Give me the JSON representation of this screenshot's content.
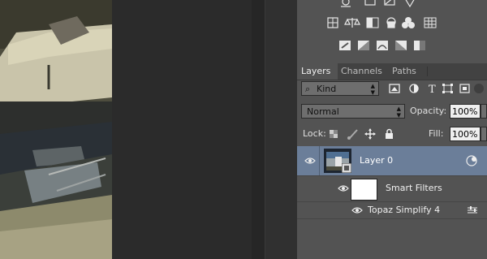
{
  "colors": {
    "panel_bg": "#535353",
    "selected_layer_bg": "#6b7e99",
    "tab_bar_bg": "#424242",
    "pasteboard": "#2b2b2b"
  },
  "adjustments": {
    "icons": [
      "brightness-contrast-icon",
      "levels-icon",
      "curves-icon",
      "exposure-icon",
      "vibrance-icon",
      "hue-saturation-icon",
      "color-balance-icon",
      "black-white-icon",
      "photo-filter-icon",
      "channel-mixer-icon",
      "color-lookup-icon",
      "invert-icon",
      "posterize-icon",
      "threshold-icon",
      "gradient-map-icon",
      "selective-color-icon"
    ]
  },
  "tabs": [
    {
      "label": "Layers",
      "active": true
    },
    {
      "label": "Channels",
      "active": false
    },
    {
      "label": "Paths",
      "active": false
    }
  ],
  "filter": {
    "kind_label": "Kind"
  },
  "blend": {
    "mode": "Normal",
    "opacity_label": "Opacity:",
    "opacity_value": "100%"
  },
  "lock": {
    "label": "Lock:",
    "fill_label": "Fill:",
    "fill_value": "100%"
  },
  "layers": [
    {
      "name": "Layer 0",
      "selected": true,
      "visible": true
    },
    {
      "name": "Smart Filters",
      "visible": true
    },
    {
      "name": "Topaz Simplify 4",
      "visible": true
    }
  ]
}
